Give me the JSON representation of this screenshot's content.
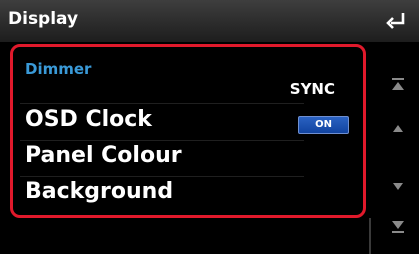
{
  "header": {
    "title": "Display"
  },
  "icons": {
    "back": "back-arrow-icon",
    "top": "scroll-top-icon",
    "up": "scroll-up-icon",
    "down": "scroll-down-icon",
    "bottom": "scroll-bottom-icon"
  },
  "colors": {
    "accent_red": "#e0192b",
    "label_blue": "#3a9ad8",
    "toggle_blue": "#1f55b5"
  },
  "items": [
    {
      "label": "Dimmer",
      "value": "SYNC"
    },
    {
      "label": "OSD Clock",
      "value": "ON"
    },
    {
      "label": "Panel Colour"
    },
    {
      "label": "Background"
    }
  ]
}
